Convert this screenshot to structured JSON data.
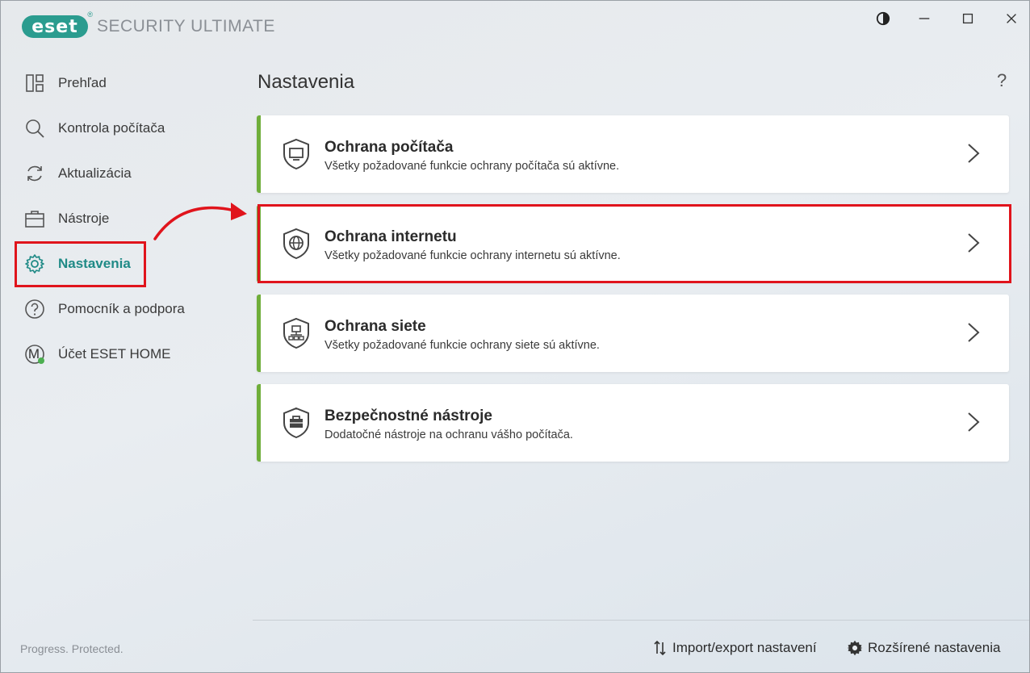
{
  "app": {
    "logo_text": "eset",
    "logo_reg": "®",
    "product_name": "SECURITY ULTIMATE"
  },
  "window_controls": {
    "theme_icon": "contrast-icon",
    "minimize_icon": "minimize-icon",
    "maximize_icon": "maximize-icon",
    "close_icon": "close-icon"
  },
  "sidebar": {
    "items": [
      {
        "label": "Prehľad",
        "icon": "dashboard-icon"
      },
      {
        "label": "Kontrola počítača",
        "icon": "search-icon"
      },
      {
        "label": "Aktualizácia",
        "icon": "refresh-icon"
      },
      {
        "label": "Nástroje",
        "icon": "briefcase-icon"
      },
      {
        "label": "Nastavenia",
        "icon": "gear-icon",
        "active": true
      },
      {
        "label": "Pomocník a podpora",
        "icon": "help-circle-icon"
      },
      {
        "label": "Účet ESET HOME",
        "icon": "account-avatar-icon",
        "avatar_letter": "M"
      }
    ],
    "footer": "Progress. Protected."
  },
  "main": {
    "title": "Nastavenia",
    "help": "?",
    "cards": [
      {
        "title": "Ochrana počítača",
        "desc": "Všetky požadované funkcie ochrany počítača sú aktívne.",
        "icon": "shield-monitor-icon"
      },
      {
        "title": "Ochrana internetu",
        "desc": "Všetky požadované funkcie ochrany internetu sú aktívne.",
        "icon": "shield-globe-icon"
      },
      {
        "title": "Ochrana siete",
        "desc": "Všetky požadované funkcie ochrany siete sú aktívne.",
        "icon": "shield-network-icon"
      },
      {
        "title": "Bezpečnostné nástroje",
        "desc": "Dodatočné nástroje na ochranu vášho počítača.",
        "icon": "shield-toolbox-icon"
      }
    ]
  },
  "bottom": {
    "import_export": "Import/export nastavení",
    "advanced": "Rozšírené nastavenia"
  },
  "colors": {
    "accent": "#1f8a86",
    "status_green": "#6fae3a",
    "annotation_red": "#e0141c"
  }
}
